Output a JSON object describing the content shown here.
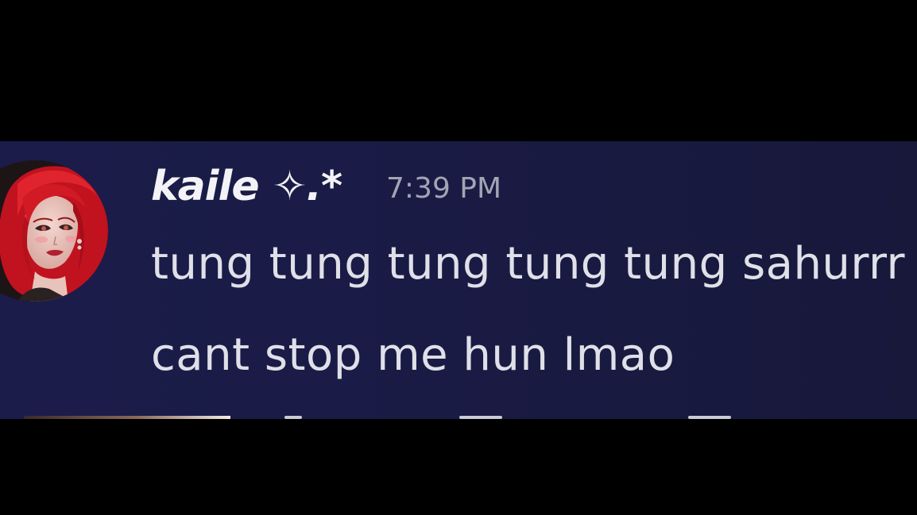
{
  "message": {
    "username": "kaile ✧.*",
    "timestamp": "7:39 PM",
    "lines": [
      "tung tung tung tung tung sahurrr",
      "cant stop me hun lmao"
    ]
  },
  "avatar": {
    "icon": "red-haired-character-avatar"
  },
  "colors": {
    "page_background": "#000000",
    "message_background": "#1b1c4a",
    "username": "#f3f3f7",
    "timestamp": "#a3a5b4",
    "message_text": "#dfe0e8"
  }
}
